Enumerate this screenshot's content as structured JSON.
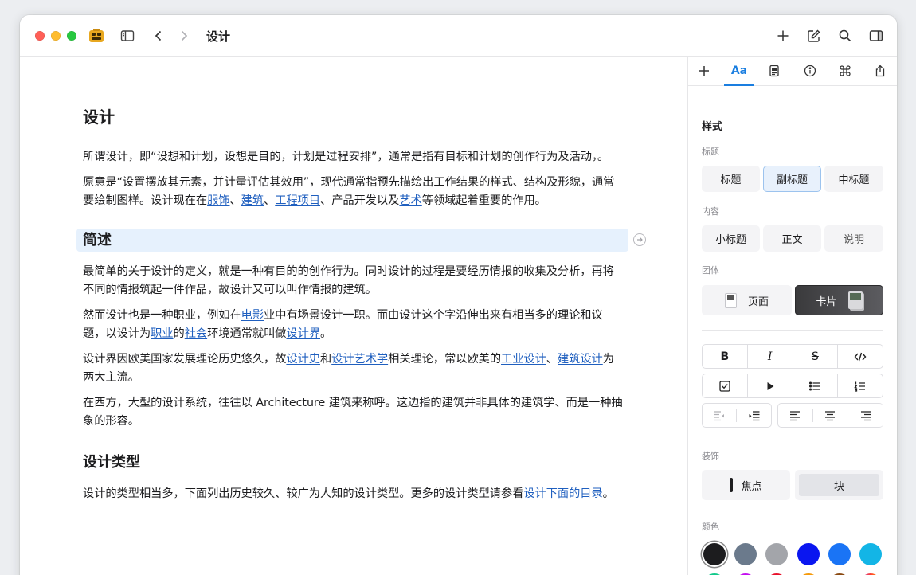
{
  "window": {
    "title": "设计"
  },
  "document": {
    "title": "设计",
    "intro1": {
      "pre": "所谓设计，即“设想和计划，设想是目的，计划是过程安排”，通常是指有目标和计划的创作行为及活动，。"
    },
    "intro2": {
      "pre": "原意是“设置摆放其元素，并计量评估其效用”，现代通常指预先描绘出工作结果的样式、结构及形貌，通常要绘制图样。设计现在在",
      "l1": "服饰",
      "s1": "、",
      "l2": "建筑",
      "s2": "、",
      "l3": "工程项目",
      "s3": "、产品开发以及",
      "l4": "艺术",
      "post": "等领域起着重要的作用。"
    },
    "section1_title": "简述",
    "p1": "最简单的关于设计的定义，就是一种有目的的创作行为。同时设计的过程是要经历情报的收集及分析，再将不同的情报筑起一件作品，故设计又可以叫作情报的建筑。",
    "p2": {
      "a": "然而设计也是一种职业，例如在",
      "l1": "电影",
      "b": "业中有场景设计一职。而由设计这个字沿伸出来有相当多的理论和议题，以设计为",
      "l2": "职业",
      "c": "的",
      "l3": "社会",
      "d": "环境通常就叫做",
      "l4": "设计界",
      "e": "。"
    },
    "p3": {
      "a": "设计界因欧美国家发展理论历史悠久，故",
      "l1": "设计史",
      "b": "和",
      "l2": "设计艺术学",
      "c": "相关理论，常以欧美的",
      "l3": "工业设计",
      "d": "、",
      "l4": "建筑设计",
      "e": "为两大主流。"
    },
    "p4": "在西方，大型的设计系统，往往以 Architecture 建筑来称呼。这边指的建筑并非具体的建筑学、而是一种抽象的形容。",
    "section2_title": "设计类型",
    "p5": {
      "a": "设计的类型相当多，下面列出历史较久、较广为人知的设计类型。更多的设计类型请参看",
      "l1": "设计下面的目录",
      "b": "。"
    }
  },
  "inspector": {
    "tabs": {
      "text_tab": "Aa"
    },
    "style_title": "样式",
    "heading_label": "标题",
    "heading_options": [
      "标题",
      "副标题",
      "中标题"
    ],
    "content_label": "内容",
    "content_options": [
      "小标题",
      "正文",
      "说明"
    ],
    "group_label": "团体",
    "group_options": [
      "页面",
      "卡片"
    ],
    "format": {
      "bold": "B",
      "italic": "I",
      "strike": "S"
    },
    "decoration_label": "装饰",
    "decoration_options": [
      "焦点",
      "块"
    ],
    "color_label": "颜色",
    "colors": [
      "#1c1c1e",
      "#6b7a8c",
      "#a3a5aa",
      "#0a16f0",
      "#1a74f5",
      "#13b5e6",
      "#12c98a",
      "#c40ef0",
      "#e8102a",
      "#f59a0b",
      "#8a4a12",
      "#ffffff"
    ]
  }
}
